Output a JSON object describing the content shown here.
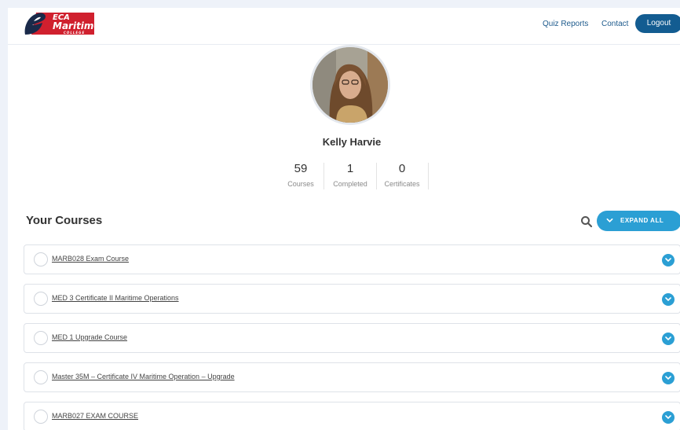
{
  "header": {
    "logo": {
      "text_1": "ECA",
      "text_2": "Maritime",
      "text_3": "COLLEGE"
    },
    "nav": {
      "quiz_reports": "Quiz Reports",
      "contact": "Contact",
      "logout": "Logout"
    }
  },
  "profile": {
    "name": "Kelly Harvie",
    "stats": [
      {
        "value": "59",
        "label": "Courses"
      },
      {
        "value": "1",
        "label": "Completed"
      },
      {
        "value": "0",
        "label": "Certificates"
      }
    ]
  },
  "courses_section": {
    "title": "Your Courses",
    "expand_all_label": "EXPAND ALL",
    "search_icon": "search-icon"
  },
  "courses": [
    {
      "title": "MARB028 Exam Course"
    },
    {
      "title": "MED 3 Certificate II Maritime Operations"
    },
    {
      "title": "MED 1 Upgrade Course"
    },
    {
      "title": "Master 35M – Certificate IV Maritime Operation – Upgrade"
    },
    {
      "title": "MARB027 EXAM COURSE"
    }
  ],
  "colors": {
    "primary": "#135c91",
    "accent": "#2b9fd4",
    "logo_red": "#d0202e",
    "background": "#eef2f9"
  }
}
